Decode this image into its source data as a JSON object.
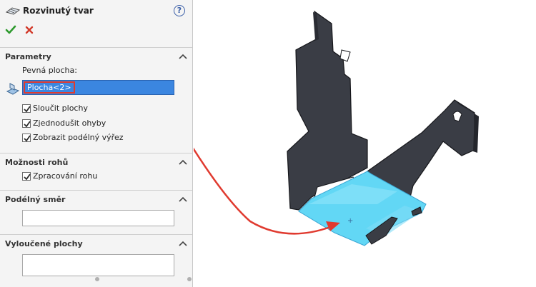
{
  "panel": {
    "title": "Rozvinutý tvar",
    "help_glyph": "?",
    "ok_icon": "check-icon",
    "cancel_icon": "close-icon"
  },
  "sections": {
    "parameters": {
      "title": "Parametry",
      "fixed_face_label": "Pevná plocha:",
      "fixed_face_value": "Plocha<2>",
      "options": [
        {
          "label": "Sloučit plochy",
          "checked": true
        },
        {
          "label": "Zjednodušit ohyby",
          "checked": true
        },
        {
          "label": "Zobrazit podélný výřez",
          "checked": true
        }
      ]
    },
    "corner_options": {
      "title": "Možnosti rohů",
      "options": [
        {
          "label": "Zpracování rohu",
          "checked": true
        }
      ]
    },
    "grain_direction": {
      "title": "Podélný směr",
      "value": ""
    },
    "excluded_faces": {
      "title": "Vyloučené plochy",
      "value": ""
    }
  },
  "colors": {
    "selection_blue": "#3b86e0",
    "callout_red": "#e03a2f",
    "part_dark": "#3a3d45",
    "highlight_cyan": "#62d7f5"
  }
}
